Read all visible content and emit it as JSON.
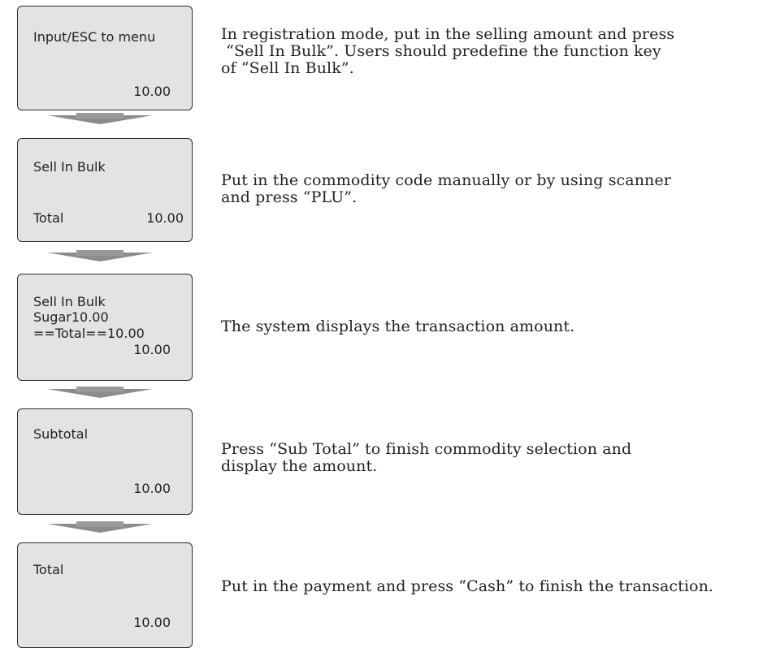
{
  "steps": [
    {
      "screen": {
        "line1": "Input/ESC to menu",
        "amount": "10.00"
      },
      "description": [
        "In registration mode, put in the selling amount and press",
        " “Sell In Bulk”. Users should predefine the function key",
        "of “Sell In Bulk”."
      ]
    },
    {
      "screen": {
        "line1": "Sell In Bulk",
        "total_label": "Total",
        "total_value": "10.00"
      },
      "description": [
        "Put in the commodity code manually or by using scanner",
        "and press “PLU”."
      ]
    },
    {
      "screen": {
        "line1": "Sell In Bulk",
        "line2": "Sugar10.00",
        "line3": "==Total==10.00",
        "amount": "10.00"
      },
      "description": [
        "The system displays the transaction amount."
      ]
    },
    {
      "screen": {
        "line1": "Subtotal",
        "amount": "10.00"
      },
      "description": [
        "Press “Sub Total” to finish commodity selection and",
        "display the amount."
      ]
    },
    {
      "screen": {
        "line1": "Total",
        "amount": "10.00"
      },
      "description": [
        "Put in the payment and press “Cash” to finish the transaction."
      ]
    }
  ]
}
